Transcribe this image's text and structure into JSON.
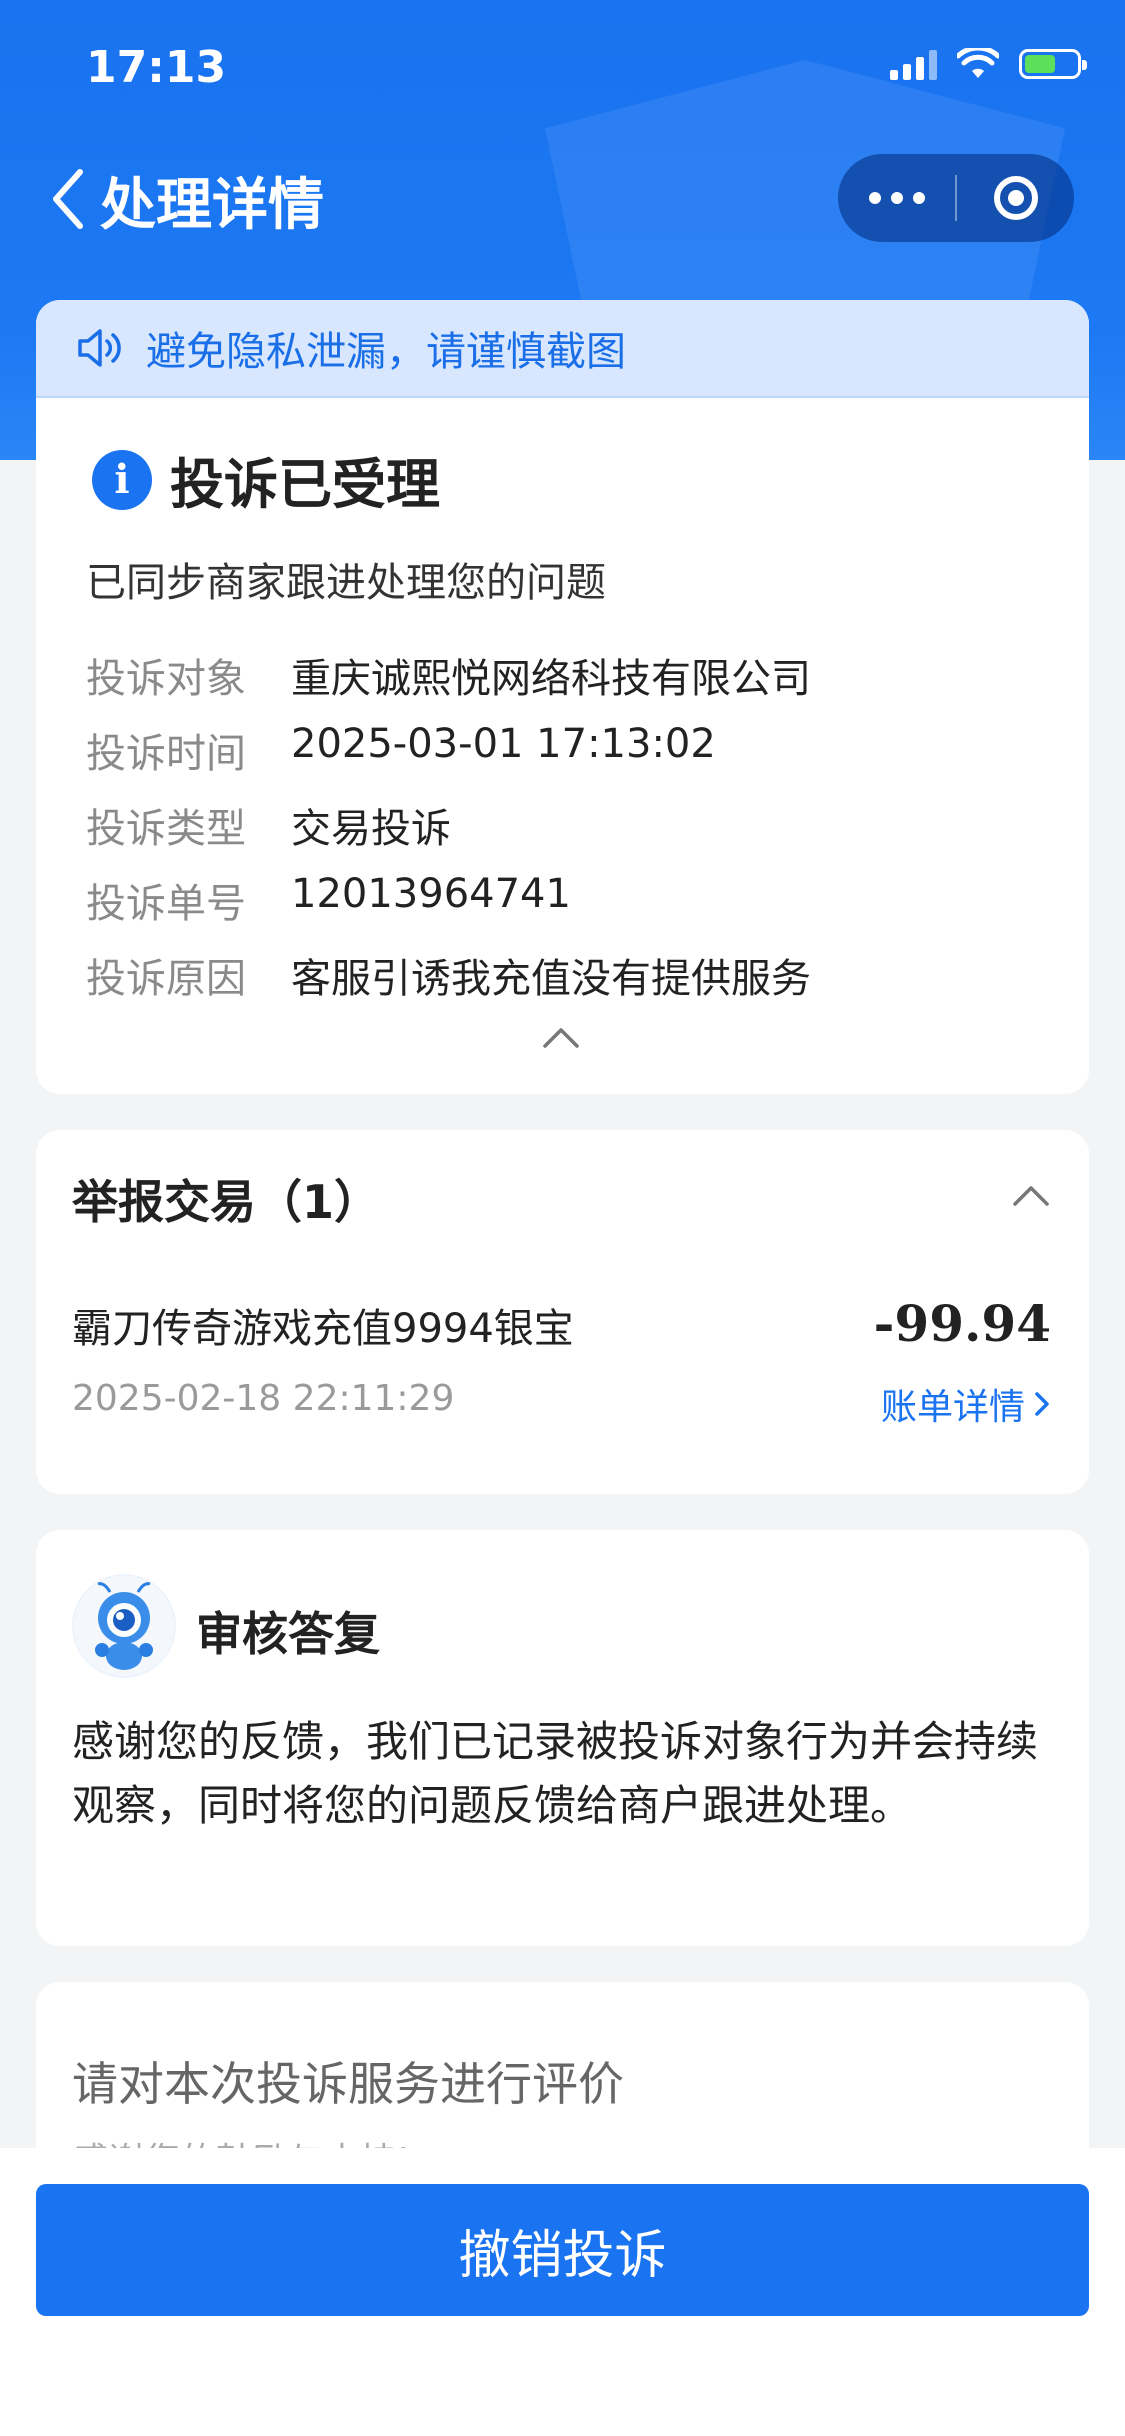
{
  "status_bar": {
    "time": "17:13"
  },
  "nav": {
    "title": "处理详情"
  },
  "notice": {
    "text": "避免隐私泄漏，请谨慎截图"
  },
  "complaint": {
    "status_title": "投诉已受理",
    "subline": "已同步商家跟进处理您的问题",
    "fields": [
      {
        "key": "投诉对象",
        "value": "重庆诚熙悦网络科技有限公司"
      },
      {
        "key": "投诉时间",
        "value": "2025-03-01 17:13:02"
      },
      {
        "key": "投诉类型",
        "value": "交易投诉"
      },
      {
        "key": "投诉单号",
        "value": "12013964741"
      },
      {
        "key": "投诉原因",
        "value": "客服引诱我充值没有提供服务"
      }
    ]
  },
  "transactions": {
    "title": "举报交易（1）",
    "items": [
      {
        "name": "霸刀传奇游戏充值9994银宝",
        "amount": "-99.94",
        "time": "2025-02-18 22:11:29",
        "link": "账单详情"
      }
    ]
  },
  "review": {
    "title": "审核答复",
    "text": "感谢您的反馈，我们已记录被投诉对象行为并会持续观察，同时将您的问题反馈给商户跟进处理。"
  },
  "rating": {
    "title": "请对本次投诉服务进行评价",
    "subtitle": "感谢您的鼓励与支持!"
  },
  "actions": {
    "cancel": "撤销投诉"
  },
  "colors": {
    "primary": "#1a73f0",
    "notice_bg": "#d8e7fd",
    "page_bg": "#f3f4f6"
  }
}
